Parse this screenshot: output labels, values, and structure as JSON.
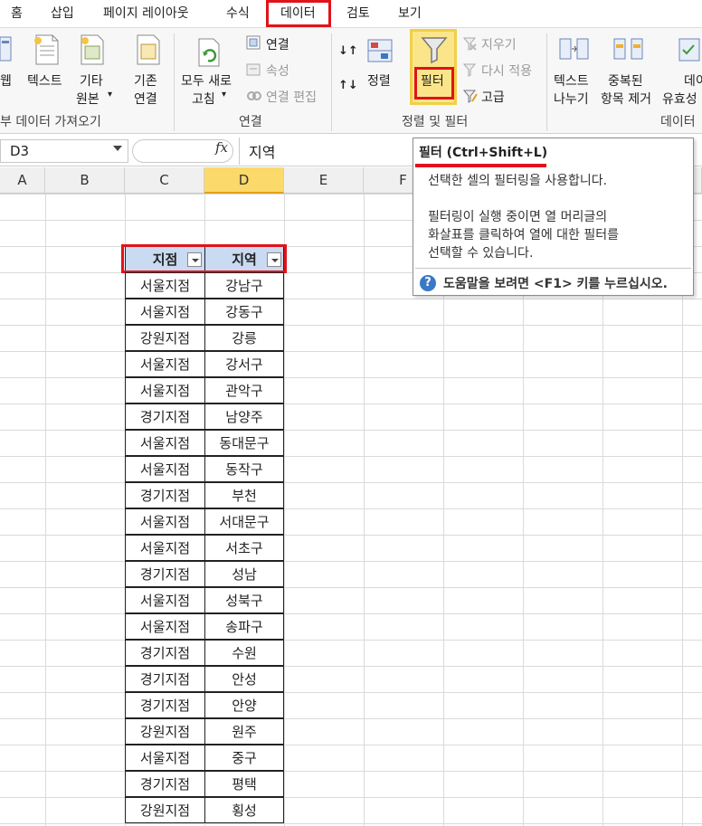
{
  "tabs": [
    "홈",
    "삽입",
    "페이지 레이아웃",
    "수식",
    "데이터",
    "검토",
    "보기"
  ],
  "ribbon": {
    "external_data": {
      "web": "웹",
      "text": "텍스트",
      "other_1": "기타",
      "other_2": "원본",
      "group_label": "부 데이터 가져오기"
    },
    "connections": {
      "existing_1": "기존",
      "existing_2": "연결",
      "refresh_1": "모두 새로",
      "refresh_2": "고침",
      "connect": "연결",
      "properties": "속성",
      "edit_links": "연결 편집",
      "group_label": "연결"
    },
    "sort_filter": {
      "sort": "정렬",
      "filter": "필터",
      "clear": "지우기",
      "reapply": "다시 적용",
      "advanced": "고급",
      "group_label": "정렬 및 필터"
    },
    "data_tools": {
      "text_to_columns_1": "텍스트",
      "text_to_columns_2": "나누기",
      "remove_dup_1": "중복된",
      "remove_dup_2": "항목 제거",
      "validation_1": "데이",
      "validation_2": "유효성",
      "group_label": "데이터"
    }
  },
  "formula_bar": {
    "name_box": "D3",
    "fx": "fx",
    "value": "지역"
  },
  "columns": [
    "A",
    "B",
    "C",
    "D",
    "E",
    "F"
  ],
  "table": {
    "headers": [
      "지점",
      "지역"
    ],
    "rows": [
      [
        "서울지점",
        "강남구"
      ],
      [
        "서울지점",
        "강동구"
      ],
      [
        "강원지점",
        "강릉"
      ],
      [
        "서울지점",
        "강서구"
      ],
      [
        "서울지점",
        "관악구"
      ],
      [
        "경기지점",
        "남양주"
      ],
      [
        "서울지점",
        "동대문구"
      ],
      [
        "서울지점",
        "동작구"
      ],
      [
        "경기지점",
        "부천"
      ],
      [
        "서울지점",
        "서대문구"
      ],
      [
        "서울지점",
        "서초구"
      ],
      [
        "경기지점",
        "성남"
      ],
      [
        "서울지점",
        "성북구"
      ],
      [
        "서울지점",
        "송파구"
      ],
      [
        "경기지점",
        "수원"
      ],
      [
        "경기지점",
        "안성"
      ],
      [
        "경기지점",
        "안양"
      ],
      [
        "강원지점",
        "원주"
      ],
      [
        "서울지점",
        "중구"
      ],
      [
        "경기지점",
        "평택"
      ],
      [
        "강원지점",
        "횡성"
      ]
    ]
  },
  "tooltip": {
    "title": "필터 (Ctrl+Shift+L)",
    "line1": "선택한 셀의 필터링을 사용합니다.",
    "line2": "필터링이 실행 중이면 열 머리글의",
    "line3": "화살표를 클릭하여 열에 대한 필터를",
    "line4": "선택할 수 있습니다.",
    "help": "도움말을 보려면 <F1> 키를 누르십시오."
  },
  "colors": {
    "highlight_red": "#e0131b",
    "header_fill": "#c9daf1",
    "filter_yellow": "#fbe58a",
    "selected_col": "#fbd96a"
  }
}
